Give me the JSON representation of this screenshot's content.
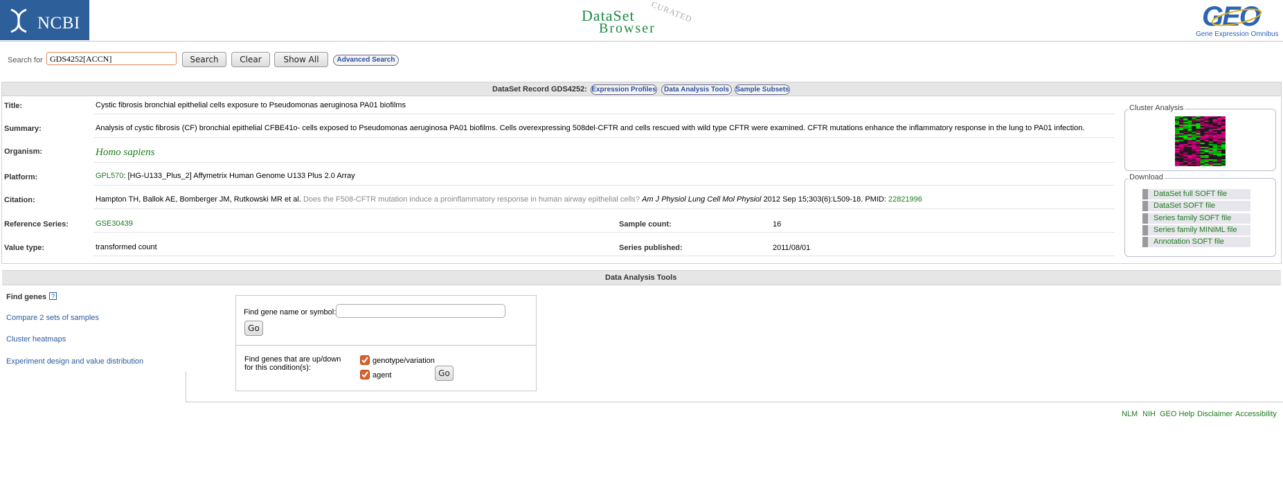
{
  "header": {
    "ncbi_logo": "NCBI",
    "browser_logo_line1": "DataSet",
    "browser_logo_line2": "Browser",
    "browser_logo_curated": "CURATED",
    "geo_logo": "GEO",
    "geo_subtitle": "Gene Expression Omnibus"
  },
  "search": {
    "label": "Search for",
    "query": "GDS4252[ACCN]",
    "search_label": "Search",
    "clear_label": "Clear",
    "show_all_label": "Show All",
    "advanced_label": "Advanced Search"
  },
  "record": {
    "bar_title": "DataSet Record GDS4252:",
    "tabs": [
      "Expression Profiles",
      "Data Analysis Tools",
      "Sample Subsets"
    ],
    "title_label": "Title:",
    "title": "Cystic fibrosis bronchial epithelial cells exposure to Pseudomonas aeruginosa PA01 biofilms",
    "summary_label": "Summary:",
    "summary": "Analysis of cystic fibrosis (CF) bronchial epithelial CFBE41o- cells exposed to Pseudomonas aeruginosa PA01 biofilms. Cells overexpressing 508del-CFTR and cells rescued with wild type CFTR were examined. CFTR mutations enhance the inflammatory response in the lung to PA01 infection.",
    "organism_label": "Organism:",
    "organism": "Homo sapiens",
    "platform_label": "Platform:",
    "platform_id": "GPL570",
    "platform_desc": ": [HG-U133_Plus_2] Affymetrix Human Genome U133 Plus 2.0 Array",
    "citation_label": "Citation:",
    "citation_authors": "Hampton TH, Ballok AE, Bomberger JM, Rutkowski MR et al.",
    "citation_title": "Does the F508-CFTR mutation induce a proinflammatory response in human airway epithelial cells?",
    "citation_journal": "Am J Physiol Lung Cell Mol Physiol",
    "citation_details": "2012 Sep 15;303(6):L509-18. PMID:",
    "citation_pmid": "22821996",
    "reference_series_label": "Reference Series:",
    "reference_series": "GSE30439",
    "sample_count_label": "Sample count:",
    "sample_count": "16",
    "value_type_label": "Value type:",
    "value_type": "transformed count",
    "series_published_label": "Series published:",
    "series_published": "2011/08/01"
  },
  "cluster": {
    "legend": "Cluster Analysis"
  },
  "download": {
    "legend": "Download",
    "items": [
      "DataSet full SOFT file",
      "DataSet SOFT file",
      "Series family SOFT file",
      "Series family MINiML file",
      "Annotation SOFT file"
    ]
  },
  "tools": {
    "bar_title": "Data Analysis Tools",
    "find_genes": "Find genes",
    "help_mark": "?",
    "compare": "Compare 2 sets of samples",
    "cluster_heatmaps": "Cluster heatmaps",
    "experiment_design": "Experiment design and value distribution",
    "find_gene_label": "Find gene name or symbol:",
    "go_label": "Go",
    "updown_label_line1": "Find genes that are up/down",
    "updown_label_line2": "for this condition(s):",
    "condition_1": "genotype/variation",
    "condition_2": "agent"
  },
  "footer": {
    "links": [
      "NLM",
      "NIH",
      "GEO Help",
      "Disclaimer",
      "Accessibility"
    ]
  },
  "colors": {
    "ncbi_blue": "#2d5f9b",
    "link_green": "#1f7a1f",
    "logo_green": "#1a8a42",
    "checkbox_orange": "#d9622b"
  }
}
